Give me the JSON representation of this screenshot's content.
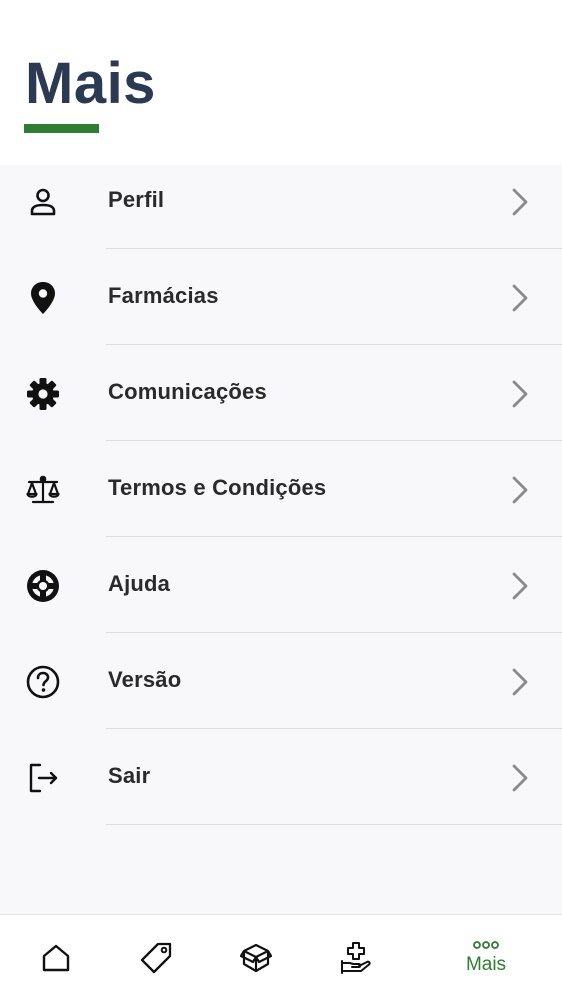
{
  "header": {
    "title": "Mais",
    "accent_color": "#2f7d32",
    "title_color": "#2b3a52"
  },
  "menu": {
    "items": [
      {
        "label": "Perfil",
        "icon": "user-icon"
      },
      {
        "label": "Farmácias",
        "icon": "map-pin-icon"
      },
      {
        "label": "Comunicações",
        "icon": "gear-icon"
      },
      {
        "label": "Termos e Condições",
        "icon": "scale-icon"
      },
      {
        "label": "Ajuda",
        "icon": "lifebuoy-icon"
      },
      {
        "label": "Versão",
        "icon": "question-circle-icon"
      },
      {
        "label": "Sair",
        "icon": "logout-icon"
      }
    ]
  },
  "tabbar": {
    "tabs": [
      {
        "icon": "home-icon",
        "label": ""
      },
      {
        "icon": "tag-icon",
        "label": ""
      },
      {
        "icon": "box-icon",
        "label": ""
      },
      {
        "icon": "hand-medical-icon",
        "label": ""
      },
      {
        "icon": "more-dots-icon",
        "label": "Mais",
        "active": true
      }
    ]
  }
}
